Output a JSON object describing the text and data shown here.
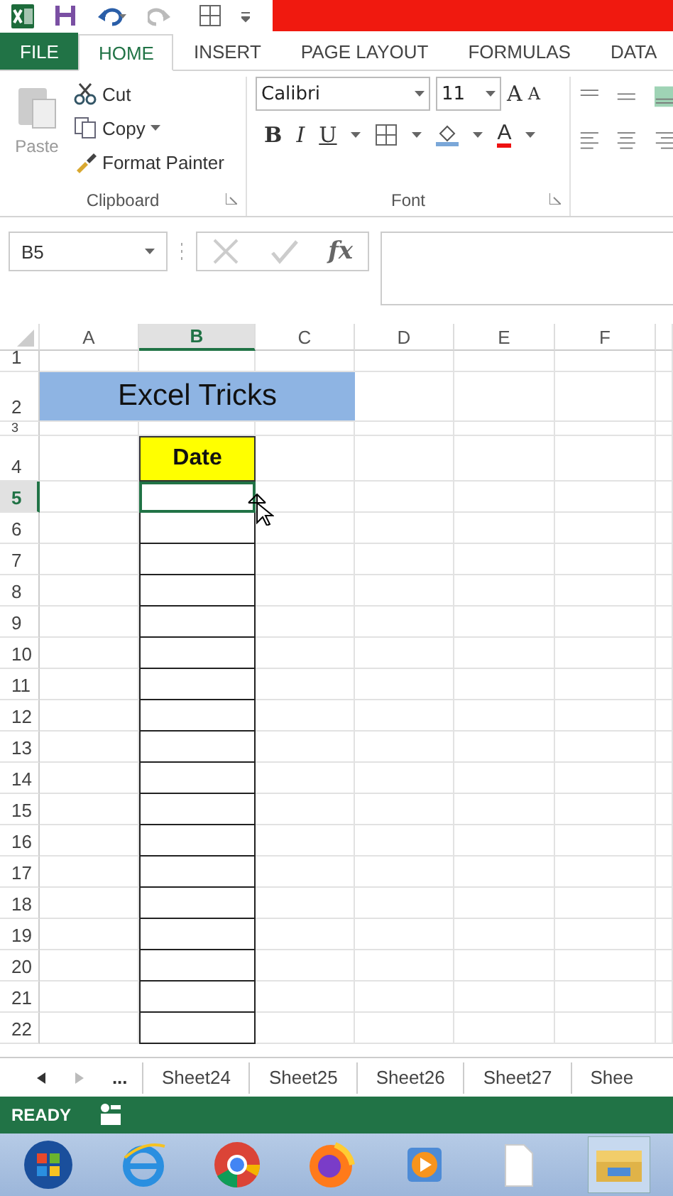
{
  "ribbon_tabs": [
    {
      "label": "FILE",
      "kind": "file",
      "selected": false
    },
    {
      "label": "HOME",
      "kind": "tab",
      "selected": true
    },
    {
      "label": "INSERT",
      "kind": "tab",
      "selected": false
    },
    {
      "label": "PAGE LAYOUT",
      "kind": "tab",
      "selected": false
    },
    {
      "label": "FORMULAS",
      "kind": "tab",
      "selected": false
    },
    {
      "label": "DATA",
      "kind": "tab",
      "selected": false
    }
  ],
  "clipboard": {
    "paste": {
      "label": "Paste",
      "disabled": true
    },
    "cut": "Cut",
    "copy": "Copy",
    "format_painter": "Format Painter",
    "group_label": "Clipboard"
  },
  "font": {
    "name": "Calibri",
    "size": "11",
    "grow": "A",
    "shrink": "A",
    "bold": "B",
    "italic": "I",
    "underline": "U",
    "font_color": "A",
    "group_label": "Font"
  },
  "formula_bar": {
    "name_box": "B5",
    "fx": "fx"
  },
  "columns": [
    {
      "label": "A",
      "selected": false
    },
    {
      "label": "B",
      "selected": true
    },
    {
      "label": "C",
      "selected": false
    },
    {
      "label": "D",
      "selected": false
    },
    {
      "label": "E",
      "selected": false
    },
    {
      "label": "F",
      "selected": false
    }
  ],
  "rows": [
    {
      "label": "1",
      "kind": "short",
      "selected": false
    },
    {
      "label": "2",
      "kind": "title",
      "text": "Excel Tricks",
      "selected": false
    },
    {
      "label": "3",
      "kind": "short",
      "selected": false
    },
    {
      "label": "4",
      "kind": "header",
      "text": "Date",
      "selected": false
    },
    {
      "label": "5",
      "kind": "bordered",
      "selected": true
    },
    {
      "label": "6",
      "kind": "bordered",
      "selected": false
    },
    {
      "label": "7",
      "kind": "bordered",
      "selected": false
    },
    {
      "label": "8",
      "kind": "bordered",
      "selected": false
    },
    {
      "label": "9",
      "kind": "bordered",
      "selected": false
    },
    {
      "label": "10",
      "kind": "bordered",
      "selected": false
    },
    {
      "label": "11",
      "kind": "bordered",
      "selected": false
    },
    {
      "label": "12",
      "kind": "bordered",
      "selected": false
    },
    {
      "label": "13",
      "kind": "bordered",
      "selected": false
    },
    {
      "label": "14",
      "kind": "bordered",
      "selected": false
    },
    {
      "label": "15",
      "kind": "bordered",
      "selected": false
    },
    {
      "label": "16",
      "kind": "bordered",
      "selected": false
    },
    {
      "label": "17",
      "kind": "bordered",
      "selected": false
    },
    {
      "label": "18",
      "kind": "bordered",
      "selected": false
    },
    {
      "label": "19",
      "kind": "bordered",
      "selected": false
    },
    {
      "label": "20",
      "kind": "bordered",
      "selected": false
    },
    {
      "label": "21",
      "kind": "bordered",
      "selected": false
    },
    {
      "label": "22",
      "kind": "bordered",
      "selected": false
    }
  ],
  "sheet_tabs": {
    "more": "...",
    "tabs": [
      "Sheet24",
      "Sheet25",
      "Sheet26",
      "Sheet27",
      "Shee"
    ]
  },
  "status_bar": {
    "mode": "READY"
  }
}
